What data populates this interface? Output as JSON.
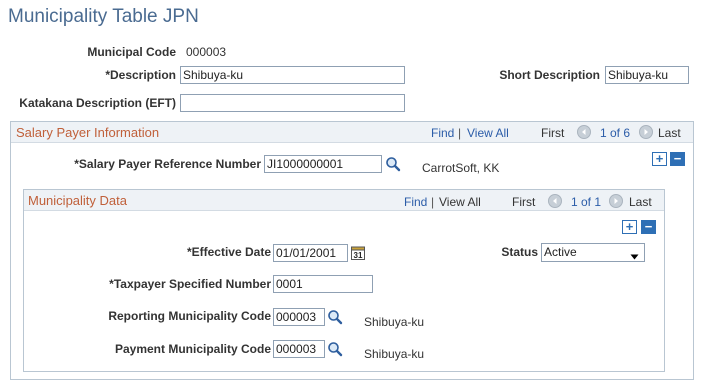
{
  "page": {
    "title": "Municipality Table JPN"
  },
  "main": {
    "municipal_code_label": "Municipal Code",
    "municipal_code_value": "000003",
    "description_label": "*Description",
    "description_value": "Shibuya-ku",
    "short_description_label": "Short Description",
    "short_description_value": "Shibuya-ku",
    "katakana_label": "Katakana Description (EFT)",
    "katakana_value": ""
  },
  "salary_payer": {
    "header": "Salary Payer Information",
    "find": "Find",
    "view_all": "View All",
    "sep": "|",
    "first": "First",
    "range": "1 of 6",
    "last": "Last",
    "ref_label": "*Salary Payer Reference Number",
    "ref_value": "JI1000000001",
    "ref_desc": "CarrotSoft, KK"
  },
  "municipality_data": {
    "header": "Municipality Data",
    "find": "Find",
    "view_all": "View All",
    "sep": "|",
    "first": "First",
    "range": "1 of 1",
    "last": "Last",
    "eff_label": "*Effective Date",
    "eff_value": "01/01/2001",
    "status_label": "Status",
    "status_value": "Active",
    "taxpayer_label": "*Taxpayer Specified Number",
    "taxpayer_value": "0001",
    "reporting_label": "Reporting Municipality Code",
    "reporting_value": "000003",
    "reporting_desc": "Shibuya-ku",
    "payment_label": "Payment Municipality Code",
    "payment_value": "000003",
    "payment_desc": "Shibuya-ku"
  },
  "icons": {
    "lookup": "magnifier-icon",
    "calendar": "calendar-icon",
    "add": "plus-icon",
    "delete": "minus-icon",
    "prev": "previous-arrow-icon",
    "next": "next-arrow-icon",
    "dropdown": "chevron-down-icon"
  },
  "colors": {
    "title": "#4a6b91",
    "section_header": "#c0603a",
    "link": "#2b5ca8",
    "accent": "#2e6fb5"
  }
}
